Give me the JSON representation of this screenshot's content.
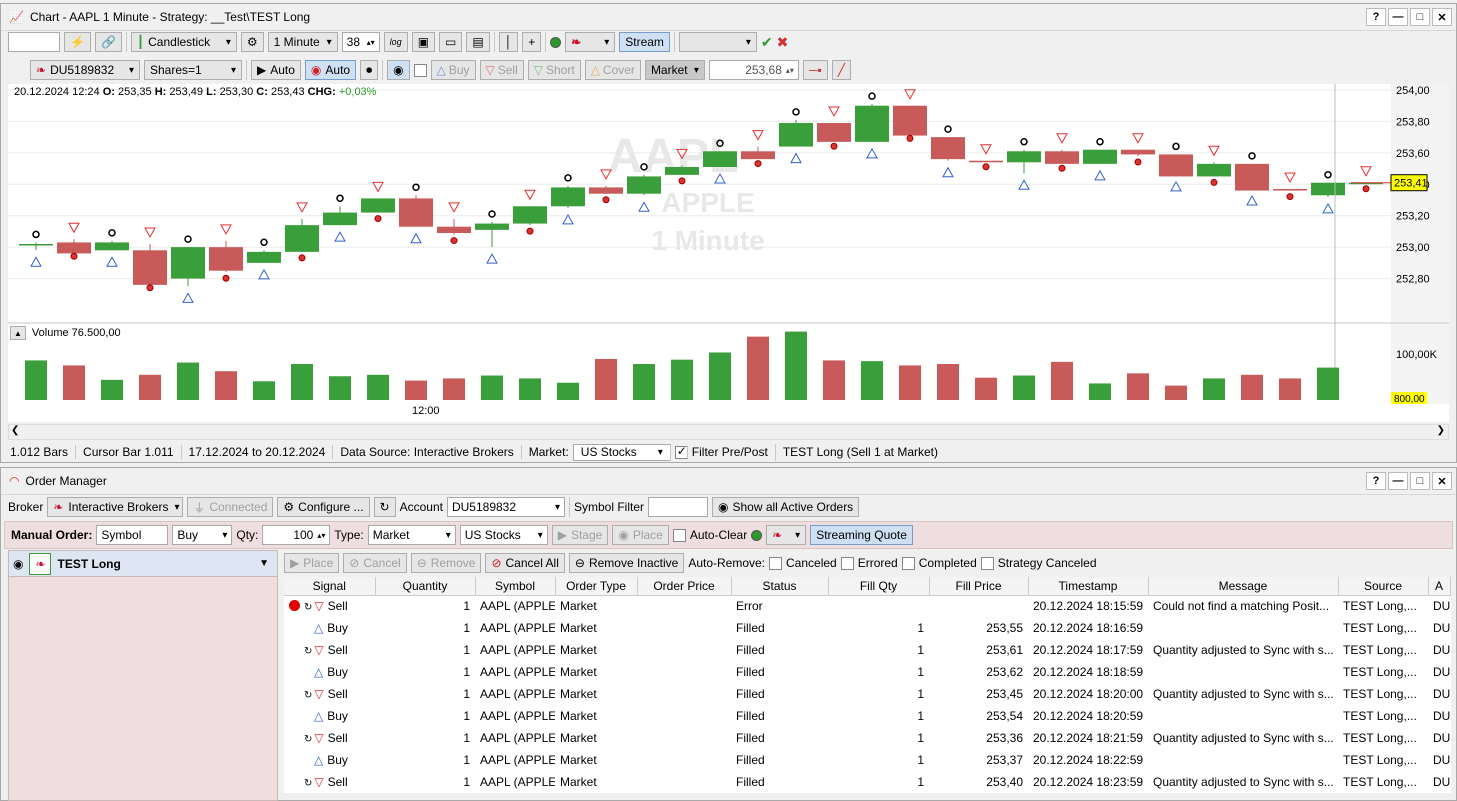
{
  "chart_window": {
    "title": "Chart - AAPL 1 Minute - Strategy: __Test\\TEST Long"
  },
  "toolbar1": {
    "chart_type": "Candlestick",
    "interval": "1 Minute",
    "bar_count": "38",
    "log_label": "log",
    "stream_label": "Stream"
  },
  "toolbar2": {
    "account": "DU5189832",
    "shares": "Shares=1",
    "auto1": "Auto",
    "auto2": "Auto",
    "buy": "Buy",
    "sell": "Sell",
    "short": "Short",
    "cover": "Cover",
    "order_type": "Market",
    "price": "253,68"
  },
  "ohlc": {
    "date": "20.12.2024 12:24",
    "o_label": "O:",
    "o": "253,35",
    "h_label": "H:",
    "h": "253,49",
    "l_label": "L:",
    "l": "253,30",
    "c_label": "C:",
    "c": "253,43",
    "chg_label": "CHG:",
    "chg": "+0,03%"
  },
  "watermark": {
    "symbol": "AAPL",
    "name": "APPLE",
    "interval": "1 Minute"
  },
  "chart_data": {
    "type": "candlestick",
    "y_ticks": [
      "254,00",
      "253,80",
      "253,60",
      "253,40",
      "253,20",
      "253,00",
      "252,80"
    ],
    "ylim": [
      252.6,
      254.0
    ],
    "last_price": "253,41",
    "x_label": "12:00",
    "candles": [
      [
        253.02,
        253.03,
        252.98,
        253.02
      ],
      [
        253.03,
        253.05,
        252.98,
        252.96
      ],
      [
        252.98,
        253.04,
        252.98,
        253.03
      ],
      [
        252.98,
        253.02,
        252.78,
        252.76
      ],
      [
        252.8,
        253.0,
        252.75,
        253.0
      ],
      [
        253.0,
        253.04,
        252.84,
        252.85
      ],
      [
        252.9,
        252.98,
        252.9,
        252.97
      ],
      [
        252.97,
        253.18,
        252.97,
        253.14
      ],
      [
        253.14,
        253.26,
        253.14,
        253.22
      ],
      [
        253.22,
        253.31,
        253.22,
        253.31
      ],
      [
        253.31,
        253.33,
        253.13,
        253.13
      ],
      [
        253.13,
        253.18,
        253.08,
        253.09
      ],
      [
        253.11,
        253.16,
        253.0,
        253.15
      ],
      [
        253.15,
        253.26,
        253.14,
        253.26
      ],
      [
        253.26,
        253.39,
        253.25,
        253.38
      ],
      [
        253.38,
        253.39,
        253.34,
        253.34
      ],
      [
        253.34,
        253.46,
        253.33,
        253.45
      ],
      [
        253.46,
        253.52,
        253.46,
        253.51
      ],
      [
        253.51,
        253.61,
        253.51,
        253.61
      ],
      [
        253.61,
        253.64,
        253.57,
        253.56
      ],
      [
        253.64,
        253.81,
        253.64,
        253.79
      ],
      [
        253.79,
        253.79,
        253.68,
        253.67
      ],
      [
        253.67,
        253.91,
        253.67,
        253.9
      ],
      [
        253.9,
        253.9,
        253.73,
        253.71
      ],
      [
        253.7,
        253.7,
        253.55,
        253.56
      ],
      [
        253.55,
        253.55,
        253.55,
        253.54
      ],
      [
        253.54,
        253.62,
        253.47,
        253.61
      ],
      [
        253.61,
        253.62,
        253.54,
        253.53
      ],
      [
        253.53,
        253.62,
        253.53,
        253.62
      ],
      [
        253.62,
        253.62,
        253.58,
        253.59
      ],
      [
        253.59,
        253.59,
        253.46,
        253.45
      ],
      [
        253.45,
        253.54,
        253.45,
        253.53
      ],
      [
        253.53,
        253.53,
        253.37,
        253.36
      ],
      [
        253.37,
        253.37,
        253.36,
        253.36
      ],
      [
        253.33,
        253.41,
        253.32,
        253.41
      ],
      [
        253.41,
        253.41,
        253.41,
        253.41
      ]
    ],
    "volume": {
      "label": "Volume 76.500,00",
      "y_ticks": [
        "100,00K",
        "800,00"
      ],
      "values": [
        55,
        48,
        28,
        35,
        52,
        40,
        26,
        50,
        33,
        35,
        27,
        30,
        34,
        30,
        24,
        57,
        50,
        56,
        66,
        88,
        95,
        55,
        54,
        48,
        50,
        31,
        34,
        53,
        23,
        37,
        20,
        30,
        35,
        30,
        45,
        0
      ]
    }
  },
  "status_bar": {
    "bars": "1.012 Bars",
    "cursor": "Cursor Bar 1.011",
    "range": "17.12.2024 to 20.12.2024",
    "source": "Data Source: Interactive Brokers",
    "market_label": "Market:",
    "market": "US Stocks",
    "filter": "Filter Pre/Post",
    "strategy": "TEST Long (Sell 1 at Market)"
  },
  "order_window": {
    "title": "Order Manager"
  },
  "om_row1": {
    "broker_label": "Broker",
    "broker": "Interactive Brokers",
    "connected": "Connected",
    "configure": "Configure ...",
    "account_label": "Account",
    "account": "DU5189832",
    "symbol_filter_label": "Symbol Filter",
    "show_all": "Show all Active Orders"
  },
  "om_row2": {
    "manual_label": "Manual Order:",
    "symbol_ph": "Symbol",
    "side": "Buy",
    "qty_label": "Qty:",
    "qty": "100",
    "type_label": "Type:",
    "type": "Market",
    "market": "US Stocks",
    "stage": "Stage",
    "place": "Place",
    "auto_clear": "Auto-Clear",
    "streaming": "Streaming Quote"
  },
  "om_row3": {
    "place": "Place",
    "cancel": "Cancel",
    "remove": "Remove",
    "cancel_all": "Cancel All",
    "remove_inactive": "Remove Inactive",
    "auto_remove": "Auto-Remove:",
    "canceled": "Canceled",
    "errored": "Errored",
    "completed": "Completed",
    "strategy_canceled": "Strategy Canceled"
  },
  "strategy_item": "TEST Long",
  "columns": [
    "Signal",
    "Quantity",
    "Symbol",
    "Order Type",
    "Order Price",
    "Status",
    "Fill Qty",
    "Fill Price",
    "Timestamp",
    "Message",
    "Source",
    "A"
  ],
  "orders": [
    {
      "signal": "Sell",
      "qty": "1",
      "symbol": "AAPL (APPLE",
      "type": "Market",
      "price": "",
      "status": "Error",
      "fill_qty": "",
      "fill_price": "",
      "ts": "20.12.2024 18:15:59",
      "msg": "Could not find a matching Posit...",
      "source": "TEST Long,...",
      "a": "DU"
    },
    {
      "signal": "Buy",
      "qty": "1",
      "symbol": "AAPL (APPLE",
      "type": "Market",
      "price": "",
      "status": "Filled",
      "fill_qty": "1",
      "fill_price": "253,55",
      "ts": "20.12.2024 18:16:59",
      "msg": "",
      "source": "TEST Long,...",
      "a": "DU"
    },
    {
      "signal": "Sell",
      "qty": "1",
      "symbol": "AAPL (APPLE",
      "type": "Market",
      "price": "",
      "status": "Filled",
      "fill_qty": "1",
      "fill_price": "253,61",
      "ts": "20.12.2024 18:17:59",
      "msg": "Quantity adjusted to Sync with s...",
      "source": "TEST Long,...",
      "a": "DU"
    },
    {
      "signal": "Buy",
      "qty": "1",
      "symbol": "AAPL (APPLE",
      "type": "Market",
      "price": "",
      "status": "Filled",
      "fill_qty": "1",
      "fill_price": "253,62",
      "ts": "20.12.2024 18:18:59",
      "msg": "",
      "source": "TEST Long,...",
      "a": "DU"
    },
    {
      "signal": "Sell",
      "qty": "1",
      "symbol": "AAPL (APPLE",
      "type": "Market",
      "price": "",
      "status": "Filled",
      "fill_qty": "1",
      "fill_price": "253,45",
      "ts": "20.12.2024 18:20:00",
      "msg": "Quantity adjusted to Sync with s...",
      "source": "TEST Long,...",
      "a": "DU"
    },
    {
      "signal": "Buy",
      "qty": "1",
      "symbol": "AAPL (APPLE",
      "type": "Market",
      "price": "",
      "status": "Filled",
      "fill_qty": "1",
      "fill_price": "253,54",
      "ts": "20.12.2024 18:20:59",
      "msg": "",
      "source": "TEST Long,...",
      "a": "DU"
    },
    {
      "signal": "Sell",
      "qty": "1",
      "symbol": "AAPL (APPLE",
      "type": "Market",
      "price": "",
      "status": "Filled",
      "fill_qty": "1",
      "fill_price": "253,36",
      "ts": "20.12.2024 18:21:59",
      "msg": "Quantity adjusted to Sync with s...",
      "source": "TEST Long,...",
      "a": "DU"
    },
    {
      "signal": "Buy",
      "qty": "1",
      "symbol": "AAPL (APPLE",
      "type": "Market",
      "price": "",
      "status": "Filled",
      "fill_qty": "1",
      "fill_price": "253,37",
      "ts": "20.12.2024 18:22:59",
      "msg": "",
      "source": "TEST Long,...",
      "a": "DU"
    },
    {
      "signal": "Sell",
      "qty": "1",
      "symbol": "AAPL (APPLE",
      "type": "Market",
      "price": "",
      "status": "Filled",
      "fill_qty": "1",
      "fill_price": "253,40",
      "ts": "20.12.2024 18:23:59",
      "msg": "Quantity adjusted to Sync with s...",
      "source": "TEST Long,...",
      "a": "DU"
    }
  ],
  "colors": {
    "up": "#3a9e3a",
    "down": "#c85a5a",
    "buy_marker": "#3060d0",
    "sell_marker": "#e03030",
    "accent": "#c8102e"
  }
}
